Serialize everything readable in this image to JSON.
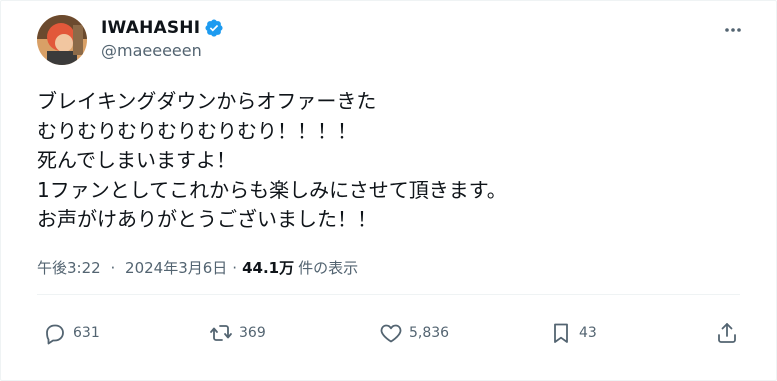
{
  "author": {
    "display_name": "IWAHASHI",
    "handle": "@maeeeeen",
    "verified": true
  },
  "tweet": {
    "lines": [
      "ブレイキングダウンからオファーきた",
      "むりむりむりむりむりむり！！！！",
      "死んでしまいますよ！",
      "1ファンとしてこれからも楽しみにさせて頂きます。",
      "お声がけありがとうございました！！"
    ]
  },
  "meta": {
    "time": "午後3:22",
    "separator": "·",
    "date": "2024年3月6日",
    "views_count": "44.1万",
    "views_label": "件の表示"
  },
  "actions": {
    "reply_count": "631",
    "retweet_count": "369",
    "like_count": "5,836",
    "bookmark_count": "43"
  },
  "icons": {
    "verified": "verified-badge-icon",
    "more": "more-dots-icon",
    "reply": "reply-bubble-icon",
    "retweet": "retweet-arrows-icon",
    "like": "heart-icon",
    "bookmark": "bookmark-icon",
    "share": "share-upload-icon"
  },
  "colors": {
    "text": "#0f1419",
    "secondary_text": "#536471",
    "verified": "#1d9bf0",
    "divider": "#eff3f4"
  }
}
